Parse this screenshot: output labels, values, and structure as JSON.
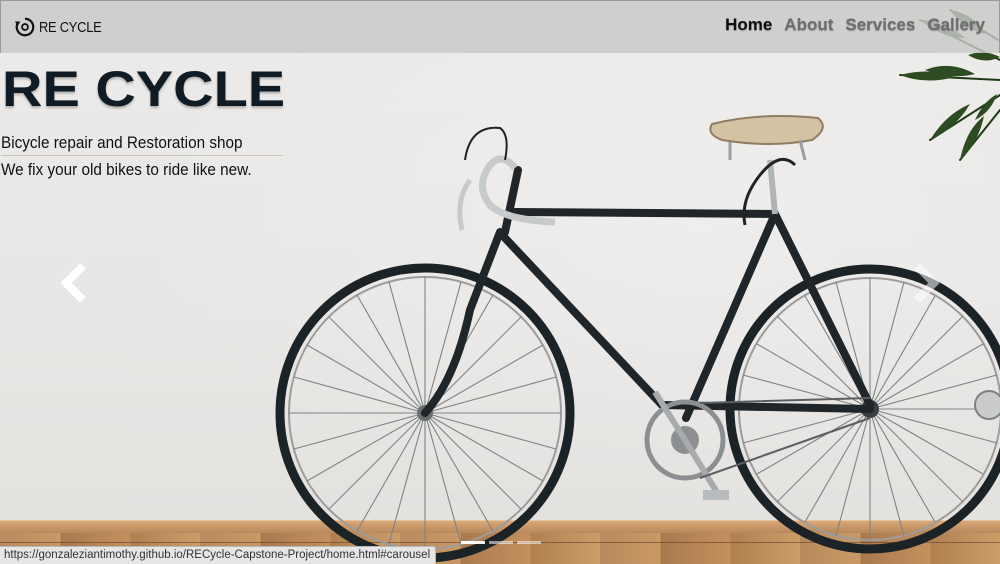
{
  "brand": {
    "name": "RE CYCLE",
    "icon": "recycle-logo-icon"
  },
  "nav": {
    "items": [
      {
        "label": "Home",
        "active": true
      },
      {
        "label": "About",
        "active": false
      },
      {
        "label": "Services",
        "active": false
      },
      {
        "label": "Gallery",
        "active": false
      }
    ]
  },
  "hero": {
    "title": "RE CYCLE",
    "subtitle": "Bicycle repair and Restoration shop",
    "tagline": "We fix your old bikes to ride like new."
  },
  "carousel": {
    "prev_icon": "chevron-left-icon",
    "next_icon": "chevron-right-icon",
    "slide_count": 3,
    "active_slide": 1
  },
  "status_bar": {
    "url": "https://gonzaleziantimothy.github.io/RECycle-Capstone-Project/home.html#carousel"
  },
  "colors": {
    "title": "#0f1c25",
    "navbar_bg": "#c8c8c8",
    "nav_active": "#0e0e0e",
    "nav_inactive": "#6e6e6e"
  }
}
